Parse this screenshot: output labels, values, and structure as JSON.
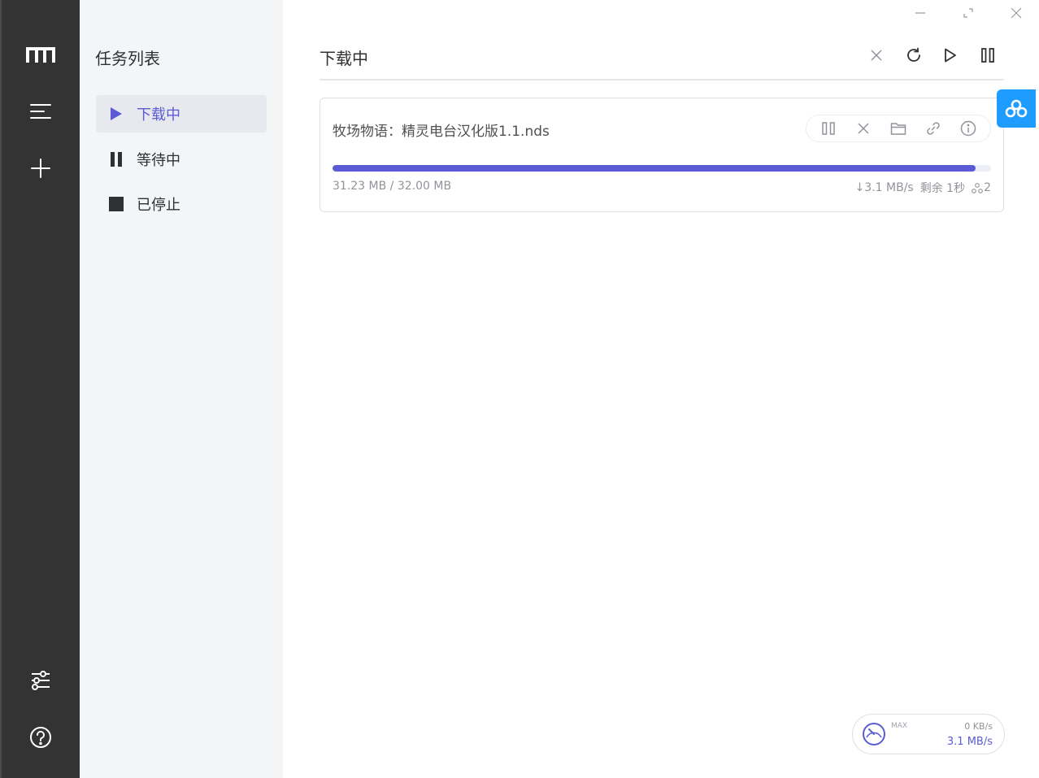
{
  "sidebar": {
    "icons": [
      "logo-m-icon",
      "menu-icon",
      "plus-icon",
      "settings-sliders-icon",
      "help-icon"
    ]
  },
  "task_list": {
    "title": "任务列表",
    "items": [
      {
        "label": "下载中",
        "icon": "play-icon",
        "active": true
      },
      {
        "label": "等待中",
        "icon": "pause-icon",
        "active": false
      },
      {
        "label": "已停止",
        "icon": "stop-icon",
        "active": false
      }
    ]
  },
  "main": {
    "title": "下载中",
    "toolbar": [
      "clear-icon",
      "refresh-icon",
      "resume-all-icon",
      "pause-all-icon"
    ]
  },
  "task": {
    "name": "牧场物语：精灵电台汉化版1.1.nds",
    "size": "31.23 MB / 32.00 MB",
    "speed": "↓3.1 MB/s",
    "remaining": "剩余 1秒",
    "connections": "2",
    "progress": 0.976
  },
  "speedometer": {
    "max_label": "MAX",
    "upload": "0 KB/s",
    "download": "3.1 MB/s"
  },
  "colors": {
    "accent": "#5b5bd6",
    "rail": "#333333",
    "float_button": "#1e9cff"
  }
}
